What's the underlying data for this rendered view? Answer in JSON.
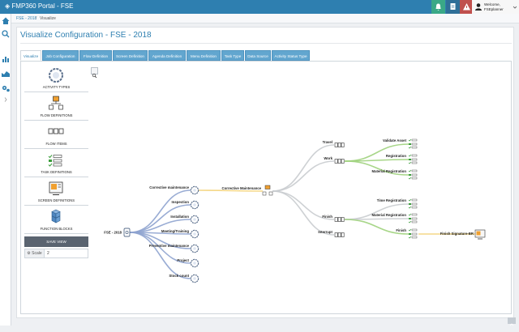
{
  "app": {
    "title": "FMP360 Portal - FSE"
  },
  "topbar": {
    "user": {
      "welcome": "Welcome,",
      "name": "FSEplanner"
    }
  },
  "breadcrumb": {
    "items": [
      "FSE - 2018",
      "Visualize"
    ]
  },
  "page": {
    "title": "Visualize Configuration - FSE - 2018"
  },
  "tabs": [
    "Visualize",
    "Job Configuration",
    "Flow Definition",
    "Screen Definition",
    "Agenda Definition",
    "Menu Definition",
    "Task Type",
    "Data Source",
    "Activity Status Type"
  ],
  "side_panel": {
    "items": [
      "ACTIVITY TYPES",
      "FLOW DEFINITIONS",
      "FLOW ITEMS",
      "TASK DEFINITIONS",
      "SCREEN DEFINITIONS",
      "FUNCTION BLOCKS"
    ],
    "save_view": "SAVE VIEW",
    "scale_label": "Scale",
    "scale_value": "2"
  },
  "graph": {
    "root": "FSE - 2018",
    "activities": [
      "Corrective maintenance",
      "Inspection",
      "Installation",
      "Meeting/Training",
      "Preventive maintenance",
      "Project",
      "Stock count"
    ],
    "flow": "Corrective Maintenance",
    "flow_items": [
      "Travel",
      "Work",
      "Finish",
      "Interrupt"
    ],
    "work_tasks": [
      "Validate Asset",
      "Registration",
      "Material Registration"
    ],
    "finish_tasks": [
      "Time Registration",
      "Material Registration",
      "Finish"
    ],
    "screen": "Finish Signature-BR"
  },
  "colors": {
    "accent": "#2e7fb0",
    "topbar": "#2e7fb0",
    "activity_link": "#8ea3cf",
    "flow_link": "#f3d37a",
    "task_link": "#9fd17c",
    "neutral_link": "#c9cccf"
  }
}
